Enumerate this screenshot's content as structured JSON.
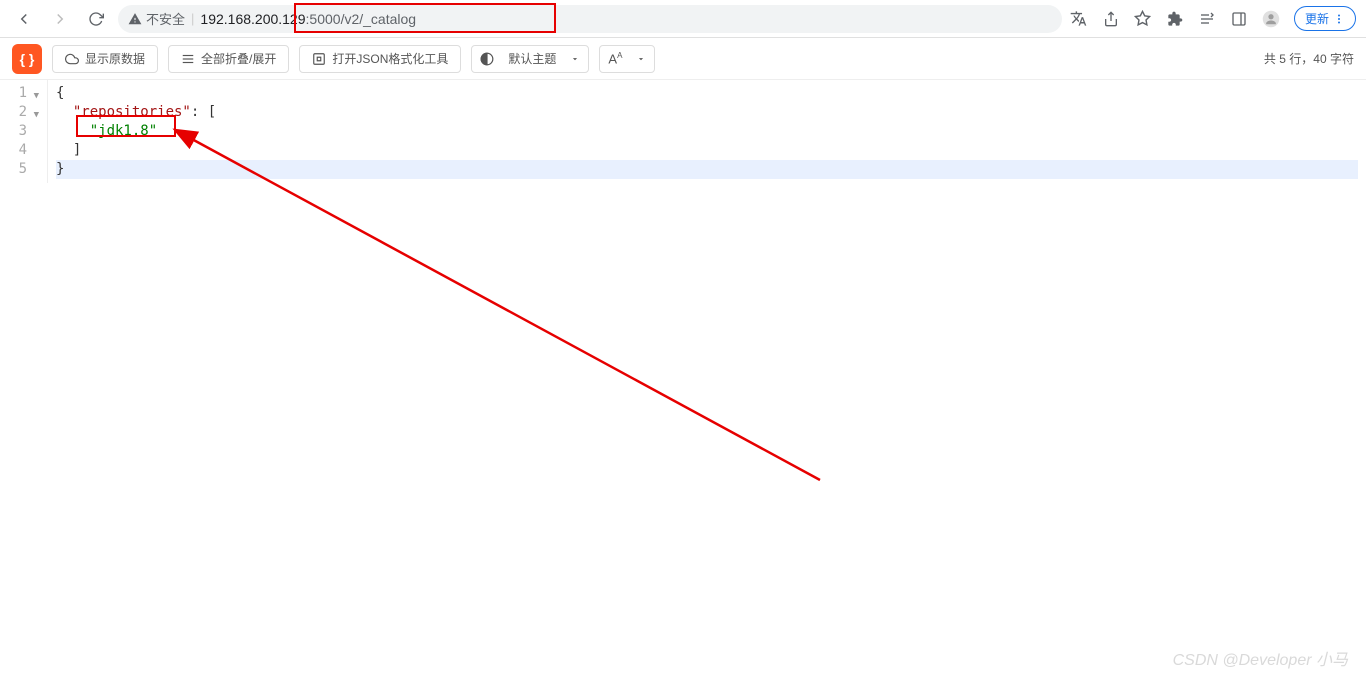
{
  "browser": {
    "insecure_label": "不安全",
    "url_host": "192.168.200.129",
    "url_port": ":5000",
    "url_path": "/v2/_catalog",
    "update_label": "更新"
  },
  "toolbar": {
    "show_raw": "显示原数据",
    "collapse_all": "全部折叠/展开",
    "open_json_tool": "打开JSON格式化工具",
    "default_theme": "默认主题",
    "font_btn": "A"
  },
  "stats": {
    "prefix": "共 ",
    "lines": "5",
    "lines_suffix": " 行，",
    "chars": "40",
    "chars_suffix": " 字符"
  },
  "code": {
    "ln1": "1",
    "ln2": "2",
    "ln3": "3",
    "ln4": "4",
    "ln5": "5",
    "l1": "{",
    "l2_key": "\"repositories\"",
    "l2_colon": ": [",
    "l3_val": "\"jdk1.8\"",
    "l4": "]",
    "l5": "}"
  },
  "watermark": "CSDN @Developer 小马"
}
